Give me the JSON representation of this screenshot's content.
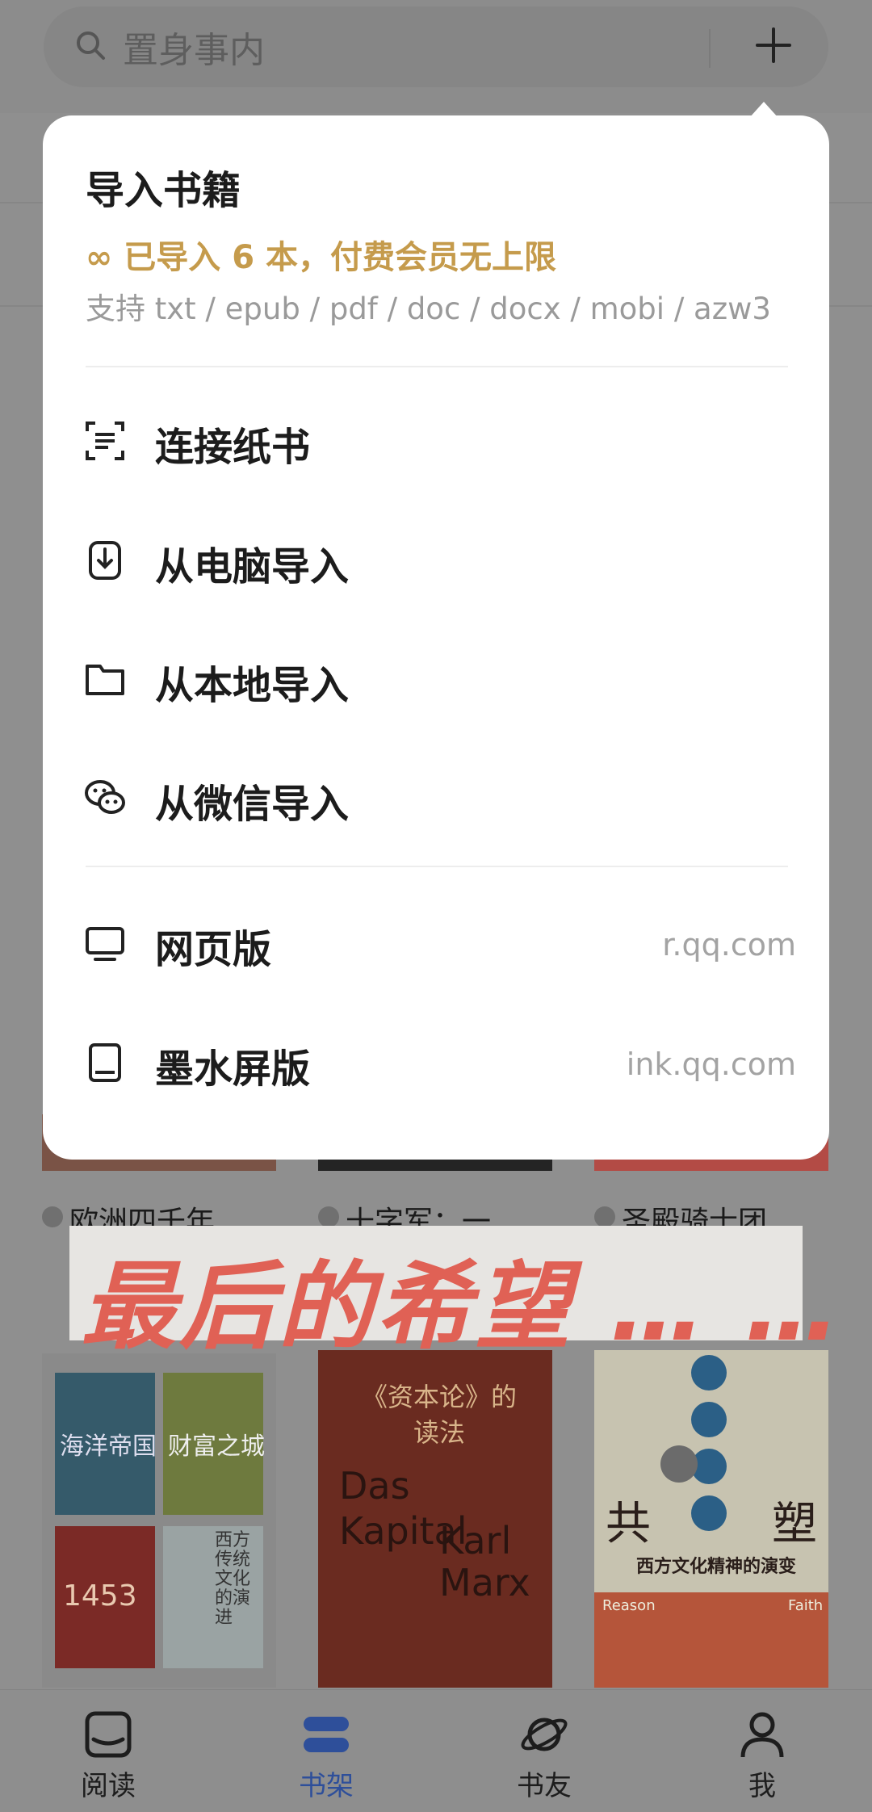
{
  "search": {
    "placeholder": "置身事内"
  },
  "popup": {
    "title": "导入书籍",
    "quota": "已导入 6 本，付费会员无上限",
    "formats": "支持 txt / epub / pdf / doc / docx / mobi / azw3",
    "items": [
      {
        "label": "连接纸书",
        "icon": "scan-icon"
      },
      {
        "label": "从电脑导入",
        "icon": "phone-import-icon"
      },
      {
        "label": "从本地导入",
        "icon": "folder-icon"
      },
      {
        "label": "从微信导入",
        "icon": "wechat-icon"
      }
    ],
    "links": [
      {
        "label": "网页版",
        "url": "r.qq.com",
        "icon": "monitor-icon"
      },
      {
        "label": "墨水屏版",
        "url": "ink.qq.com",
        "icon": "ereader-icon"
      }
    ]
  },
  "shelf": {
    "row1_titles": [
      "欧洲四千年",
      "十字军：一…",
      "圣殿骑士团…"
    ],
    "banner": "最后的希望 … …",
    "covers": {
      "c1": {
        "tl": "海洋帝国",
        "tr": "财富之城",
        "bl": "1453",
        "br": "西方传统文化的演进"
      },
      "c2": {
        "title": "《资本论》的读法",
        "de": "Das Kapital",
        "author": "Karl Marx"
      },
      "c3": {
        "a": "共",
        "b": "塑",
        "sub": "西方文化精神的演变",
        "l": "Reason",
        "r": "Faith"
      }
    }
  },
  "tabs": [
    {
      "label": "阅读",
      "icon": "book-open-icon"
    },
    {
      "label": "书架",
      "icon": "bookshelf-icon",
      "active": true
    },
    {
      "label": "书友",
      "icon": "planet-icon"
    },
    {
      "label": "我",
      "icon": "person-icon"
    }
  ],
  "colors": {
    "accent": "#c59b4c",
    "active_tab": "#2e4f9a",
    "banner_red": "#e06155"
  }
}
